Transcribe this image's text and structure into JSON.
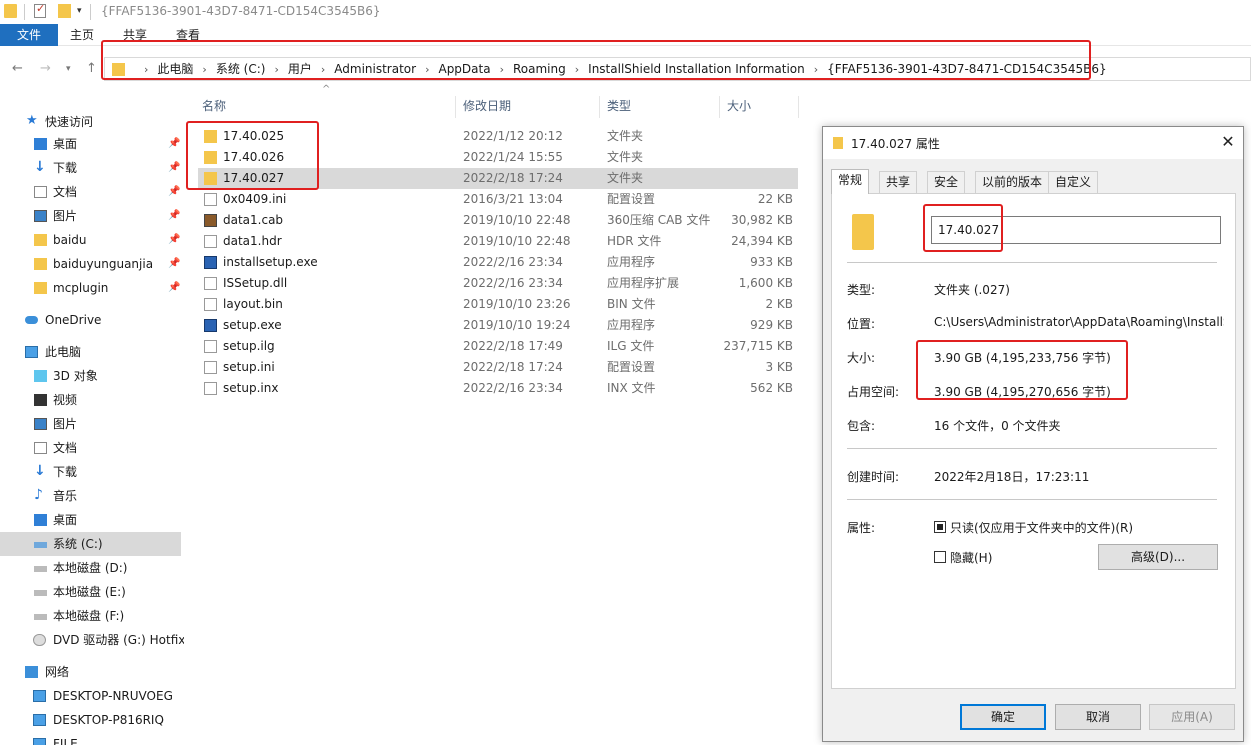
{
  "window": {
    "title": "{FFAF5136-3901-43D7-8471-CD154C3545B6}"
  },
  "ribbon": {
    "file_tab": "文件",
    "tabs": [
      "主页",
      "共享",
      "查看"
    ]
  },
  "address": {
    "crumbs": [
      "此电脑",
      "系统 (C:)",
      "用户",
      "Administrator",
      "AppData",
      "Roaming",
      "InstallShield Installation Information",
      "{FFAF5136-3901-43D7-8471-CD154C3545B6}"
    ]
  },
  "sidebar": {
    "quick_access": "快速访问",
    "quick_items": [
      "桌面",
      "下载",
      "文档",
      "图片",
      "baidu",
      "baiduyunguanjia",
      "mcplugin"
    ],
    "onedrive": "OneDrive",
    "this_pc": "此电脑",
    "pc_items": [
      "3D 对象",
      "视频",
      "图片",
      "文档",
      "下载",
      "音乐",
      "桌面",
      "系统 (C:)",
      "本地磁盘 (D:)",
      "本地磁盘 (E:)",
      "本地磁盘 (F:)",
      "DVD 驱动器 (G:) Hotfix"
    ],
    "network": "网络",
    "net_items": [
      "DESKTOP-NRUVOEG",
      "DESKTOP-P816RIQ",
      "FILE"
    ]
  },
  "filelist": {
    "columns": {
      "name": "名称",
      "date": "修改日期",
      "type": "类型",
      "size": "大小"
    },
    "rows": [
      {
        "name": "17.40.025",
        "date": "2022/1/12 20:12",
        "type": "文件夹",
        "size": "",
        "icon": "folder-icon"
      },
      {
        "name": "17.40.026",
        "date": "2022/1/24 15:55",
        "type": "文件夹",
        "size": "",
        "icon": "folder-icon"
      },
      {
        "name": "17.40.027",
        "date": "2022/2/18 17:24",
        "type": "文件夹",
        "size": "",
        "icon": "folder-icon"
      },
      {
        "name": "0x0409.ini",
        "date": "2016/3/21 13:04",
        "type": "配置设置",
        "size": "22 KB",
        "icon": "settings-file-icon"
      },
      {
        "name": "data1.cab",
        "date": "2019/10/10 22:48",
        "type": "360压缩 CAB 文件",
        "size": "30,982 KB",
        "icon": "archive-icon"
      },
      {
        "name": "data1.hdr",
        "date": "2019/10/10 22:48",
        "type": "HDR 文件",
        "size": "24,394 KB",
        "icon": "file-icon"
      },
      {
        "name": "installsetup.exe",
        "date": "2022/2/16 23:34",
        "type": "应用程序",
        "size": "933 KB",
        "icon": "exe-icon"
      },
      {
        "name": "ISSetup.dll",
        "date": "2022/2/16 23:34",
        "type": "应用程序扩展",
        "size": "1,600 KB",
        "icon": "dll-icon"
      },
      {
        "name": "layout.bin",
        "date": "2019/10/10 23:26",
        "type": "BIN 文件",
        "size": "2 KB",
        "icon": "file-icon"
      },
      {
        "name": "setup.exe",
        "date": "2019/10/10 19:24",
        "type": "应用程序",
        "size": "929 KB",
        "icon": "exe-icon"
      },
      {
        "name": "setup.ilg",
        "date": "2022/2/18 17:49",
        "type": "ILG 文件",
        "size": "237,715 KB",
        "icon": "file-icon"
      },
      {
        "name": "setup.ini",
        "date": "2022/2/18 17:24",
        "type": "配置设置",
        "size": "3 KB",
        "icon": "settings-file-icon"
      },
      {
        "name": "setup.inx",
        "date": "2022/2/16 23:34",
        "type": "INX 文件",
        "size": "562 KB",
        "icon": "file-icon"
      }
    ]
  },
  "dialog": {
    "title": "17.40.027 属性",
    "tabs": [
      "常规",
      "共享",
      "安全",
      "以前的版本",
      "自定义"
    ],
    "name": "17.40.027",
    "type_label": "类型:",
    "type_value": "文件夹 (.027)",
    "location_label": "位置:",
    "location_value": "C:\\Users\\Administrator\\AppData\\Roaming\\InstallShield Installation Information",
    "size_label": "大小:",
    "size_value": "3.90 GB (4,195,233,756 字节)",
    "disk_label": "占用空间:",
    "disk_value": "3.90 GB (4,195,270,656 字节)",
    "contains_label": "包含:",
    "contains_value": "16 个文件，0 个文件夹",
    "created_label": "创建时间:",
    "created_value": "2022年2月18日，17:23:11",
    "attr_label": "属性:",
    "readonly_label": "只读(仅应用于文件夹中的文件)(R)",
    "hidden_label": "隐藏(H)",
    "advanced_button": "高级(D)...",
    "ok": "确定",
    "cancel": "取消",
    "apply": "应用(A)"
  }
}
